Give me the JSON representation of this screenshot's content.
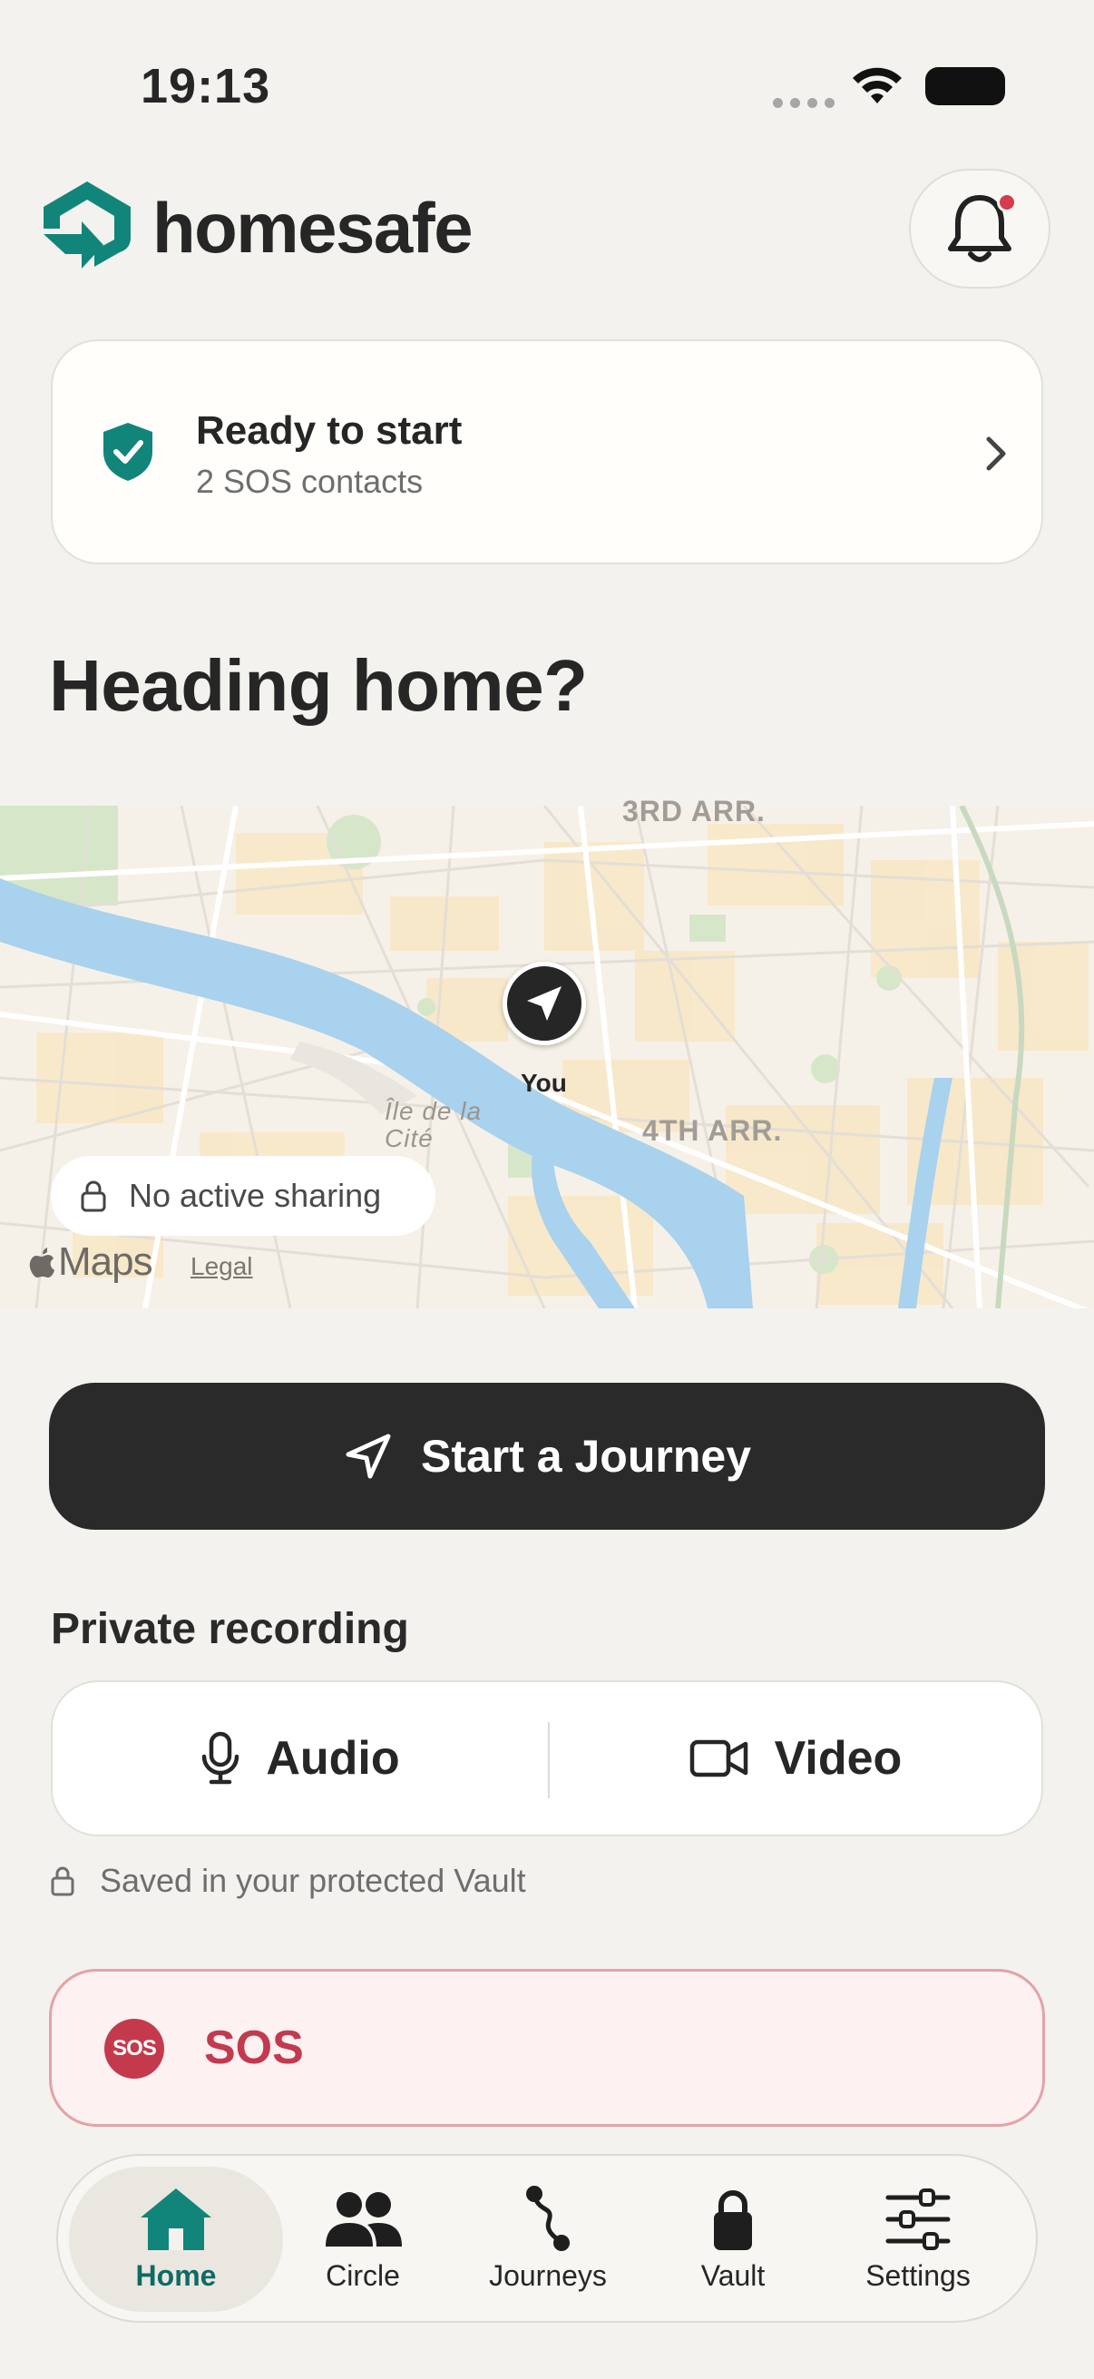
{
  "status_bar": {
    "time": "19:13"
  },
  "header": {
    "brand": "homesafe",
    "notification_unread": true
  },
  "status_card": {
    "title": "Ready to start",
    "subtitle": "2 SOS contacts"
  },
  "page_title": "Heading home?",
  "map": {
    "labels": {
      "district_3": "3RD ARR.",
      "district_4": "4TH ARR.",
      "island": "Île de la Cité"
    },
    "pin_label": "You",
    "sharing_status": "No active sharing",
    "brand": "Maps",
    "legal": "Legal"
  },
  "primary_action": {
    "label": "Start a Journey"
  },
  "recording": {
    "heading": "Private recording",
    "audio_label": "Audio",
    "video_label": "Video",
    "note": "Saved in your protected Vault"
  },
  "sos": {
    "badge": "SOS",
    "label": "SOS"
  },
  "tab_bar": {
    "active": "Home",
    "items": [
      {
        "label": "Home",
        "icon": "house-icon"
      },
      {
        "label": "Circle",
        "icon": "people-icon"
      },
      {
        "label": "Journeys",
        "icon": "route-icon"
      },
      {
        "label": "Vault",
        "icon": "lock-icon"
      },
      {
        "label": "Settings",
        "icon": "sliders-icon"
      }
    ]
  },
  "colors": {
    "brand_teal": "#12857A",
    "brand_dark": "#262626",
    "sos_red": "#C23A4E",
    "background": "#F4F2EE"
  }
}
